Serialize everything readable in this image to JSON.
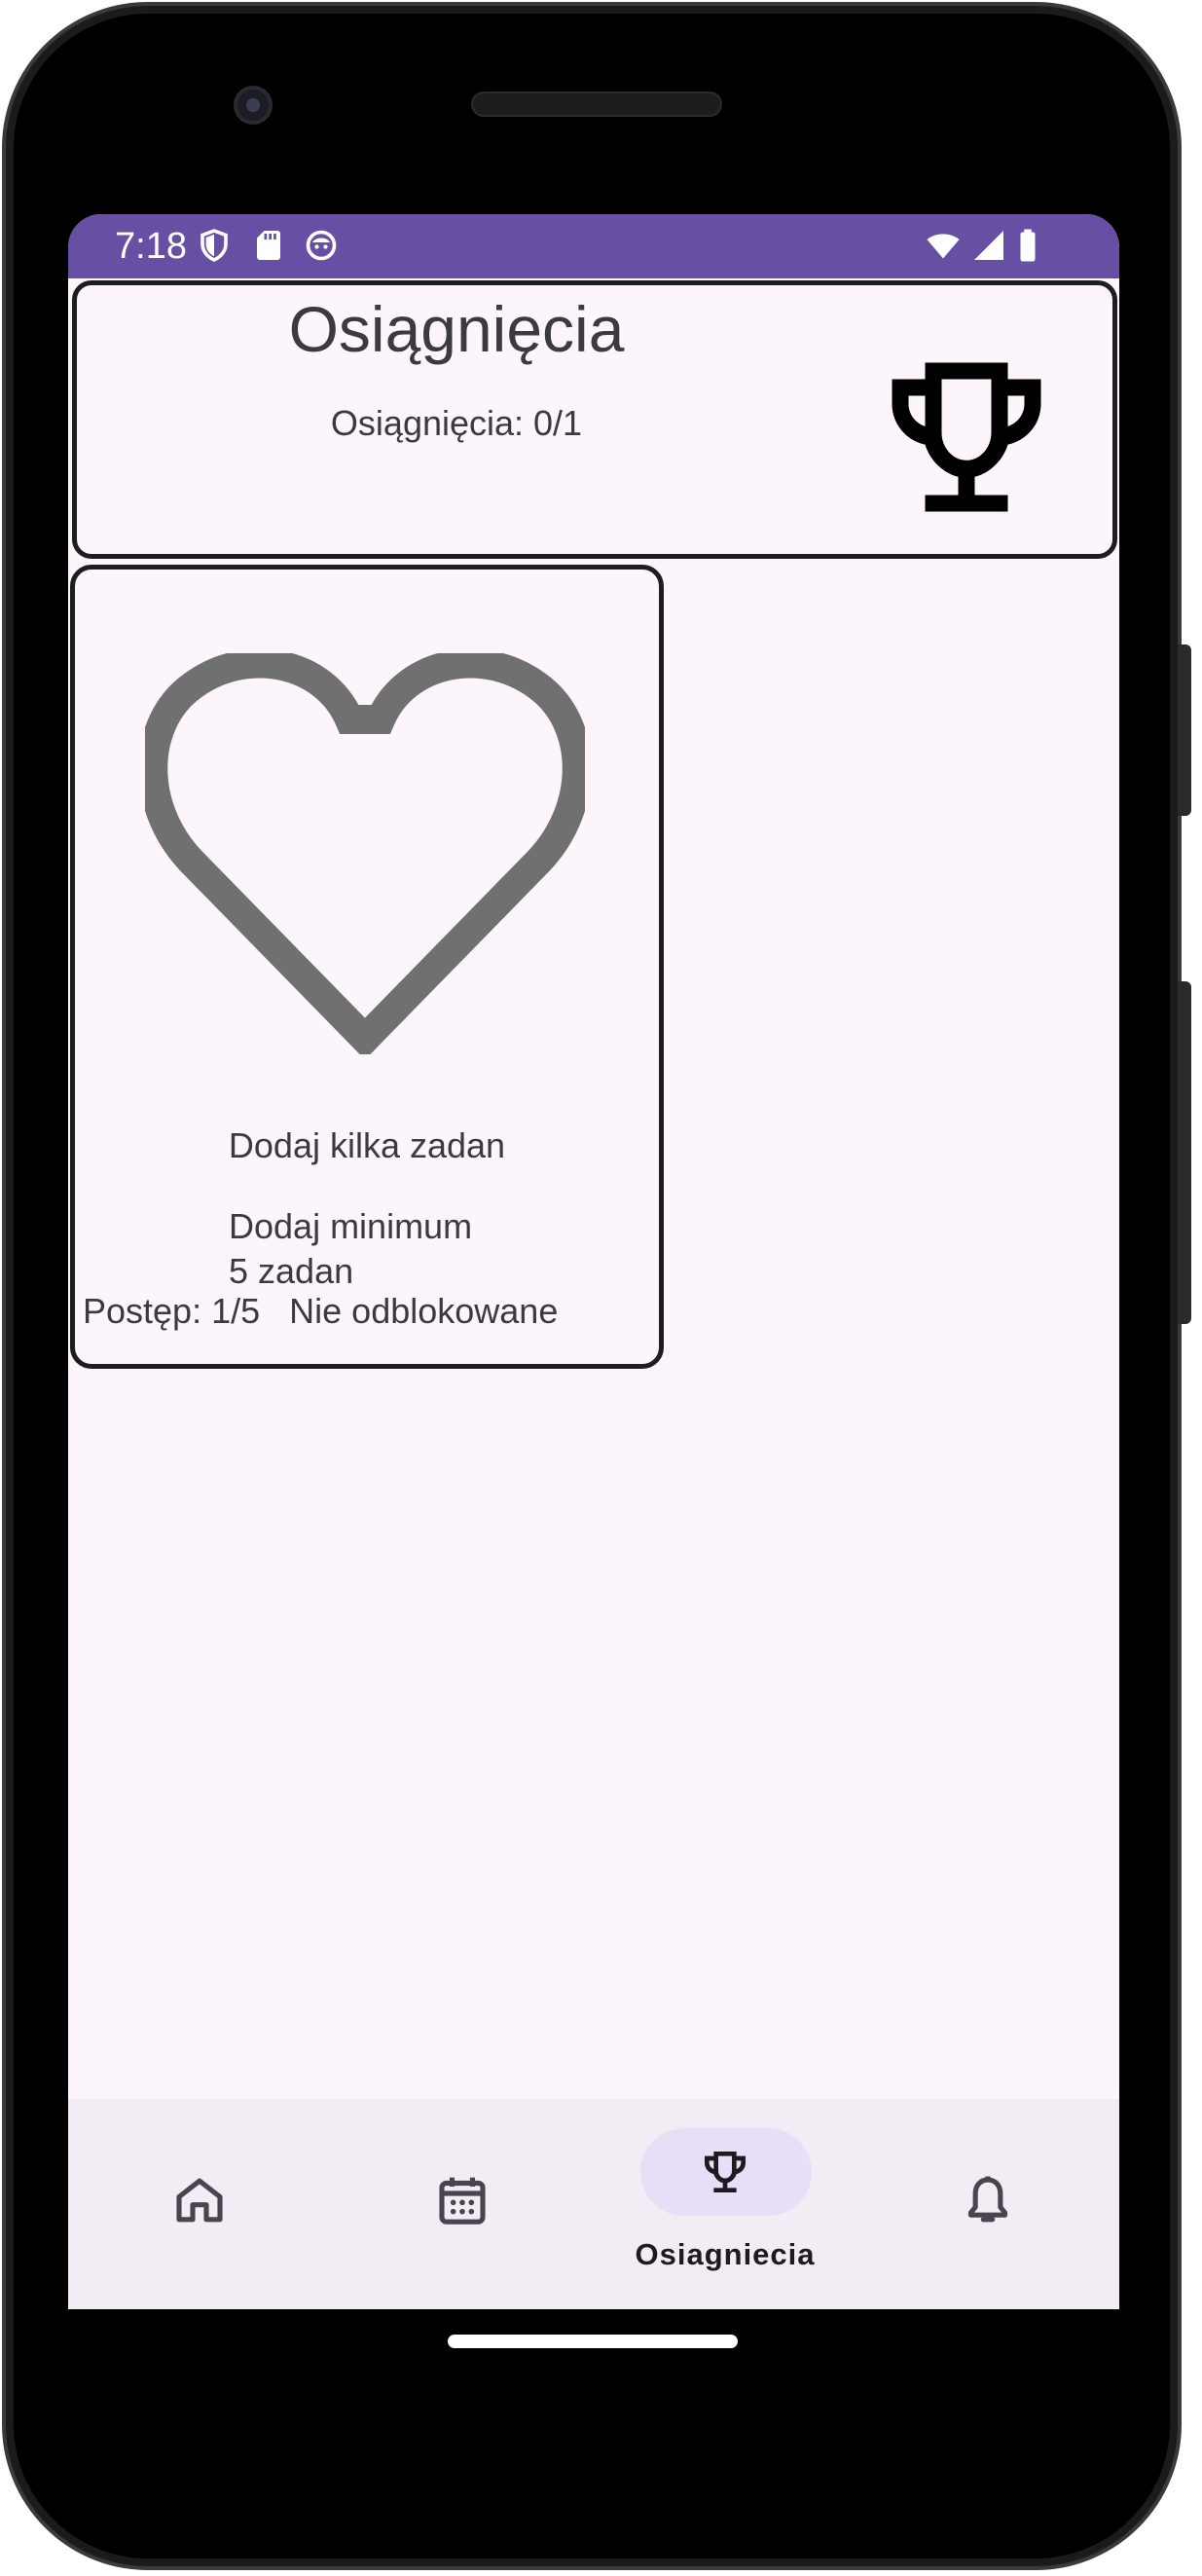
{
  "status_bar": {
    "time": "7:18",
    "left_icons": [
      "shield-icon",
      "sd-card-icon",
      "face-icon"
    ],
    "right_icons": [
      "wifi-icon",
      "signal-icon",
      "battery-icon"
    ],
    "color": "#6750a4"
  },
  "header": {
    "title": "Osiągnięcia",
    "count_text": "Osiągnięcia: 0/1",
    "icon": "trophy-icon"
  },
  "achievements": [
    {
      "icon": "heart-outline-icon",
      "title": "Dodaj kilka zadan",
      "description_line1": "Dodaj minimum",
      "description_line2": "5 zadan",
      "progress": "Postęp: 1/5",
      "status": "Nie odblokowane"
    }
  ],
  "bottom_nav": {
    "items": [
      {
        "icon": "home-icon",
        "label": "",
        "active": false
      },
      {
        "icon": "calendar-icon",
        "label": "",
        "active": false
      },
      {
        "icon": "trophy-icon",
        "label": "Osiagniecia",
        "active": true
      },
      {
        "icon": "bell-icon",
        "label": "",
        "active": false
      }
    ],
    "active_pill_color": "#e8def8"
  }
}
